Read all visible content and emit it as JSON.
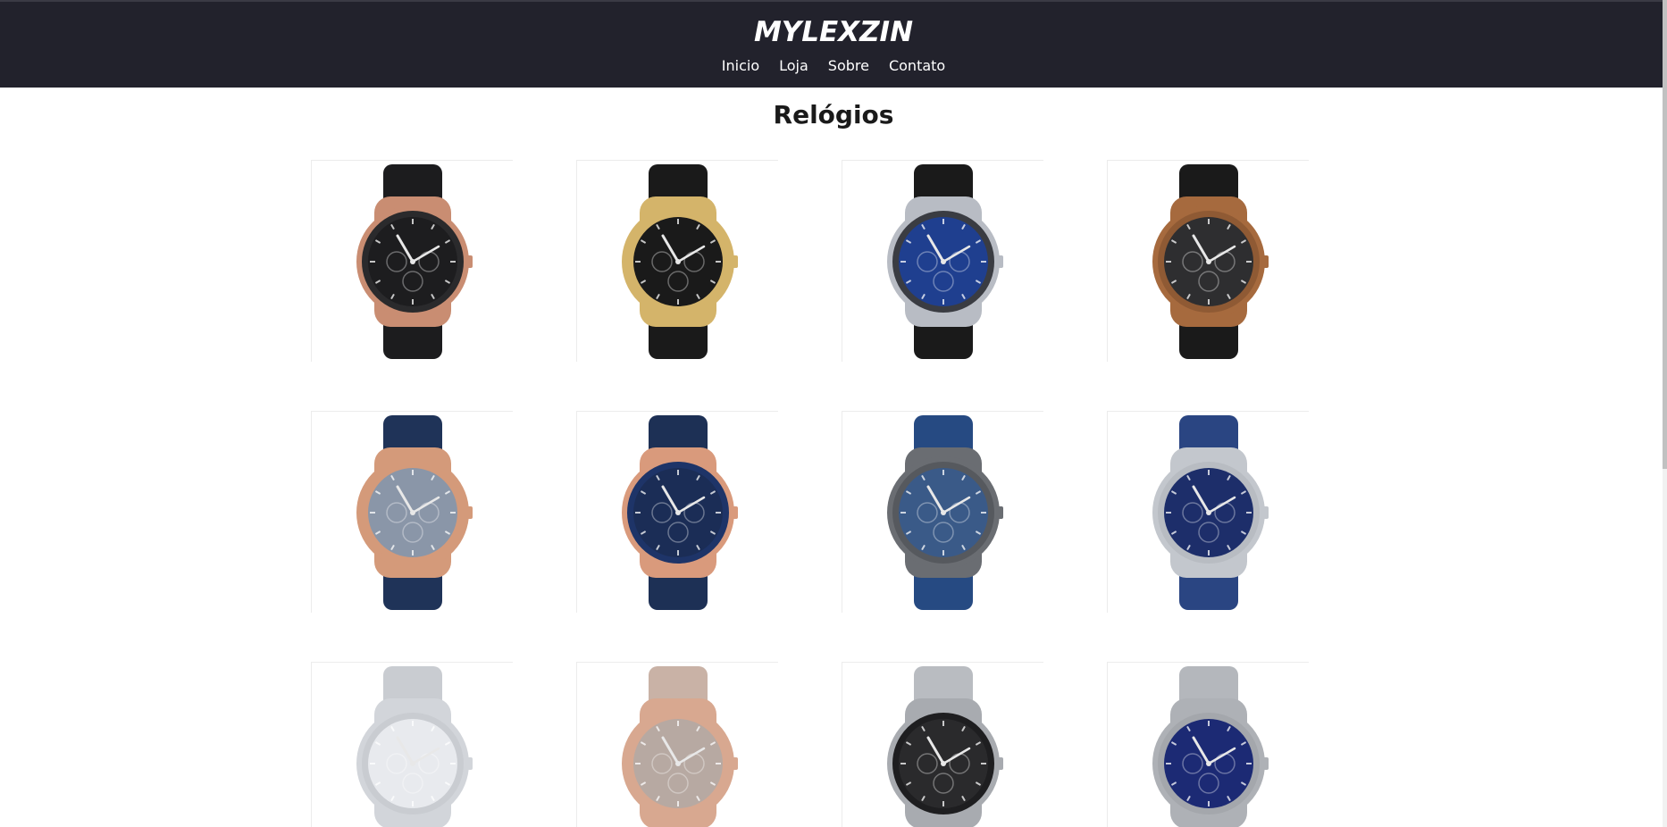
{
  "header": {
    "logo": "MYLEXZIN",
    "nav": [
      {
        "label": "Inicio"
      },
      {
        "label": "Loja"
      },
      {
        "label": "Sobre"
      },
      {
        "label": "Contato"
      }
    ]
  },
  "main": {
    "title": "Relógios"
  },
  "products": [
    {
      "name": "watch-1",
      "strap": "#1c1c1e",
      "case": "#c98d72",
      "dial": "#1d1d1f",
      "bezel": "#2a2a2c"
    },
    {
      "name": "watch-2",
      "strap": "#1a1a1a",
      "case": "#d4b46a",
      "dial": "#1a1a1a",
      "bezel": "#d4b46a"
    },
    {
      "name": "watch-3",
      "strap": "#1a1a1a",
      "case": "#b8bcc4",
      "dial": "#1f3f8f",
      "bezel": "#3a3c42"
    },
    {
      "name": "watch-4",
      "strap": "#1a1a1a",
      "case": "#a66a3e",
      "dial": "#2e2e30",
      "bezel": "#8f5a34"
    },
    {
      "name": "watch-5",
      "strap": "#1f3358",
      "case": "#d49a7a",
      "dial": "#8a96a8",
      "bezel": "#d49a7a"
    },
    {
      "name": "watch-6",
      "strap": "#1d3055",
      "case": "#d99a7c",
      "dial": "#1b2d56",
      "bezel": "#1e3468"
    },
    {
      "name": "watch-7",
      "strap": "#264a82",
      "case": "#6a6d72",
      "dial": "#3a5a88",
      "bezel": "#56595e"
    },
    {
      "name": "watch-8",
      "strap": "#2a4582",
      "case": "#c3c7cd",
      "dial": "#1d2e6a",
      "bezel": "#b8bcc2"
    },
    {
      "name": "watch-9",
      "strap": "#c9ccd1",
      "case": "#d2d5da",
      "dial": "#e8eaee",
      "bezel": "#c9ccd1"
    },
    {
      "name": "watch-10",
      "strap": "#c9b2a6",
      "case": "#d8a890",
      "dial": "#b7a9a2",
      "bezel": "#d8a890"
    },
    {
      "name": "watch-11",
      "strap": "#b9bcc1",
      "case": "#a8abb0",
      "dial": "#2a2a2c",
      "bezel": "#1e1e20"
    },
    {
      "name": "watch-12",
      "strap": "#b4b7bc",
      "case": "#aeb1b6",
      "dial": "#1c2a74",
      "bezel": "#a4a7ac"
    }
  ]
}
